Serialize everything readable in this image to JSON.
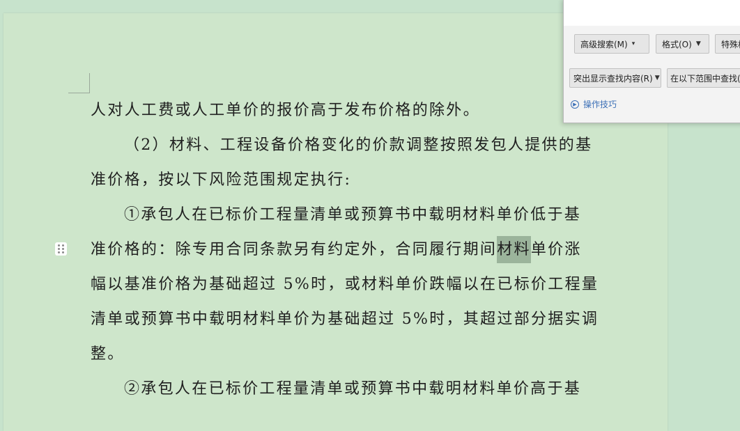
{
  "document": {
    "lines": [
      {
        "id": "l1",
        "text": "人对人工费或人工单价的报价高于发布价格的除外。"
      },
      {
        "id": "l2",
        "text": "（2）材料、工程设备价格变化的价款调整按照发包人提供的基"
      },
      {
        "id": "l3",
        "text": "准价格，按以下风险范围规定执行:"
      },
      {
        "id": "l4",
        "text": "①承包人在已标价工程量清单或预算书中载明材料单价低于基"
      },
      {
        "id": "l5a",
        "text": "准价格的：除专用合同条款另有约定外，合同履行期间"
      },
      {
        "id": "l5hl",
        "text": "材料"
      },
      {
        "id": "l5b",
        "text": "单价涨"
      },
      {
        "id": "l6",
        "text": "幅以基准价格为基础超过 5%时，或材料单价跌幅以在已标价工程量"
      },
      {
        "id": "l7",
        "text": "清单或预算书中载明材料单价为基础超过 5%时，其超过部分据实调"
      },
      {
        "id": "l8",
        "text": "整。"
      },
      {
        "id": "l9",
        "text": "②承包人在已标价工程量清单或预算书中载明材料单价高于基"
      }
    ]
  },
  "find_dialog": {
    "advanced_search": "高级搜索(M)",
    "format": "格式(O)",
    "special": "特殊格式",
    "highlight": "突出显示查找内容(R)",
    "find_in": "在以下范围中查找(I)",
    "tips": "操作技巧"
  }
}
